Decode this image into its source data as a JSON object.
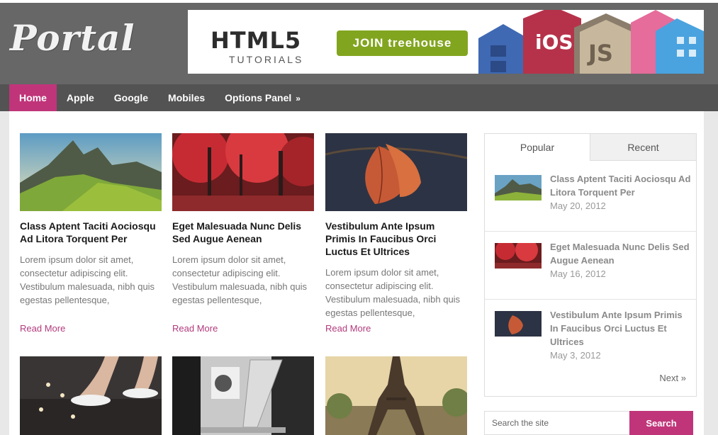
{
  "site": {
    "logo": "Portal"
  },
  "banner": {
    "title": "HTML5",
    "subtitle": "TUTORIALS",
    "button": "JOIN treehouse",
    "badge_ios": "iOS",
    "badge_js": "JS"
  },
  "nav": {
    "items": [
      {
        "label": "Home"
      },
      {
        "label": "Apple"
      },
      {
        "label": "Google"
      },
      {
        "label": "Mobiles"
      },
      {
        "label": "Options Panel"
      }
    ],
    "chevron": "»"
  },
  "posts": [
    {
      "title": "Class Aptent Taciti Aociosqu Ad Litora Torquent Per",
      "excerpt": "Lorem ipsum dolor sit amet, consectetur adipiscing elit. Vestibulum malesuada, nibh quis egestas pellentesque,",
      "read_more": "Read More"
    },
    {
      "title": "Eget Malesuada Nunc Delis Sed Augue Aenean",
      "excerpt": "Lorem ipsum dolor sit amet, consectetur adipiscing elit. Vestibulum malesuada, nibh quis egestas pellentesque,",
      "read_more": "Read More"
    },
    {
      "title": "Vestibulum Ante Ipsum Primis In Faucibus Orci Luctus Et Ultrices",
      "excerpt": "Lorem ipsum dolor sit amet, consectetur adipiscing elit. Vestibulum malesuada, nibh quis egestas pellentesque,",
      "read_more": "Read More"
    }
  ],
  "sidebar": {
    "tabs": [
      {
        "label": "Popular"
      },
      {
        "label": "Recent"
      }
    ],
    "items": [
      {
        "title": "Class Aptent Taciti Aociosqu Ad Litora Torquent Per",
        "date": "May 20, 2012"
      },
      {
        "title": "Eget Malesuada Nunc Delis Sed Augue Aenean",
        "date": "May 16, 2012"
      },
      {
        "title": "Vestibulum Ante Ipsum Primis In Faucibus Orci Luctus Et Ultrices",
        "date": "May 3, 2012"
      }
    ],
    "next": "Next »"
  },
  "search": {
    "placeholder": "Search the site",
    "button": "Search"
  },
  "colors": {
    "accent": "#c0357a",
    "header": "#676767",
    "nav": "#535353",
    "link": "#b23a7d"
  }
}
